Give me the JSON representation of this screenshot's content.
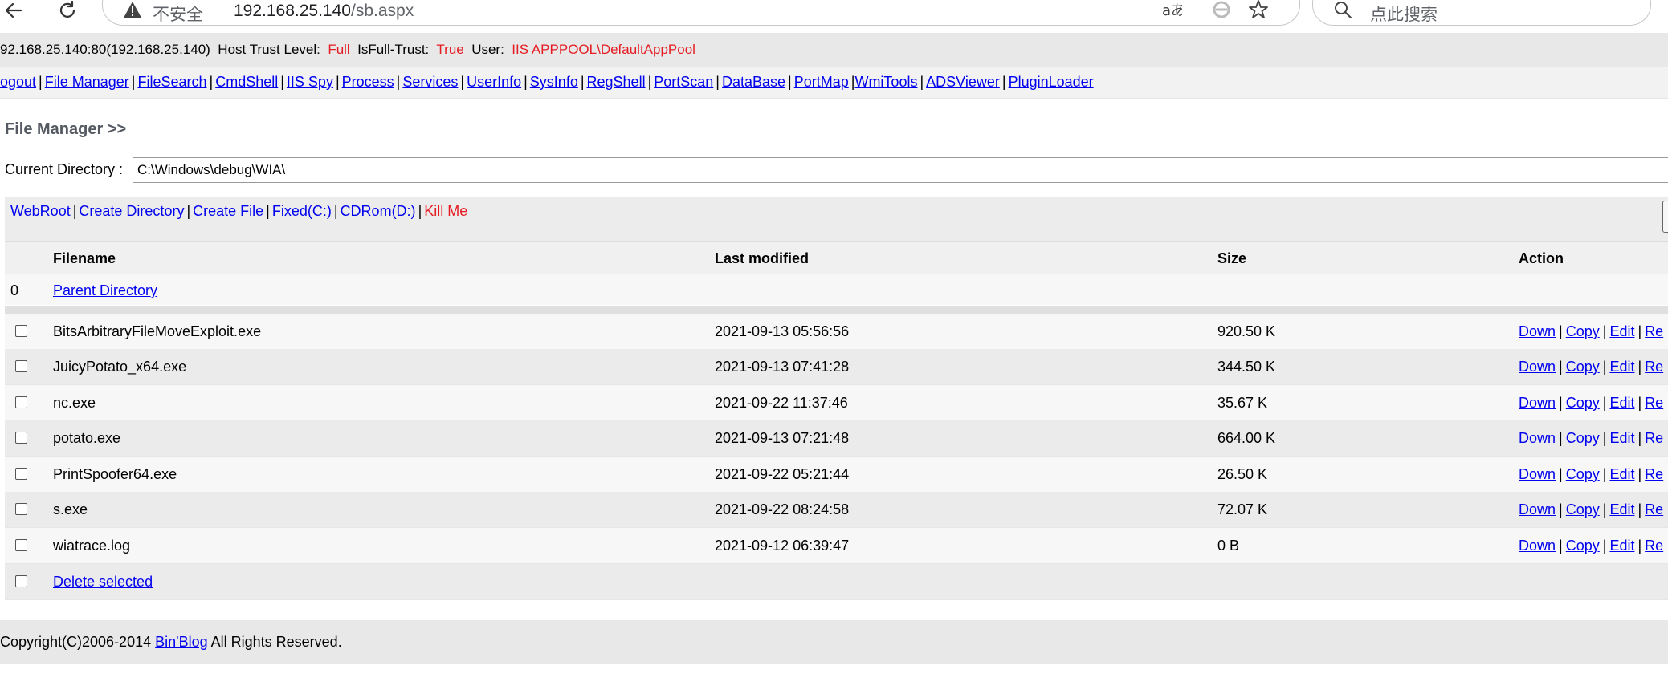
{
  "browser": {
    "insecure_label": "不安全",
    "url_host": "192.168.25.140",
    "url_path": "/sb.aspx",
    "search_placeholder": "点此搜索"
  },
  "info": {
    "host": "92.168.25.140:80(192.168.25.140)",
    "trust_label": "Host Trust Level:",
    "trust_value": "Full",
    "fulltrust_label": "IsFull-Trust:",
    "fulltrust_value": "True",
    "user_label": "User:",
    "user_value": "IIS APPPOOL\\DefaultAppPool"
  },
  "nav": {
    "logout": "ogout",
    "file_manager": "File Manager",
    "file_search": "FileSearch",
    "cmd_shell": "CmdShell",
    "iis_spy": "IIS Spy",
    "process": "Process",
    "services": "Services",
    "userinfo": "UserInfo",
    "sysinfo": "SysInfo",
    "regshell": "RegShell",
    "portscan": "PortScan",
    "database": "DataBase",
    "portmap": "PortMap",
    "wmitools": "WmiTools",
    "adsviewer": "ADSViewer",
    "pluginloader": "PluginLoader"
  },
  "heading": "File Manager >>",
  "current_dir": {
    "label": "Current Directory :",
    "value": "C:\\Windows\\debug\\WIA\\"
  },
  "quick": {
    "webroot": "WebRoot",
    "create_directory": "Create Directory",
    "create_file": "Create File",
    "fixed": "Fixed(C:)",
    "cdrom": "CDRom(D:)",
    "kill_me": "Kill Me"
  },
  "table": {
    "headers": {
      "filename": "Filename",
      "modified": "Last modified",
      "size": "Size",
      "action": "Action"
    },
    "parent": {
      "index": "0",
      "label": "Parent Directory"
    },
    "actions": {
      "down": "Down",
      "copy": "Copy",
      "edit": "Edit",
      "rename": "Re"
    },
    "files": [
      {
        "name": "BitsArbitraryFileMoveExploit.exe",
        "modified": "2021-09-13 05:56:56",
        "size": "920.50 K"
      },
      {
        "name": "JuicyPotato_x64.exe",
        "modified": "2021-09-13 07:41:28",
        "size": "344.50 K"
      },
      {
        "name": "nc.exe",
        "modified": "2021-09-22 11:37:46",
        "size": "35.67 K"
      },
      {
        "name": "potato.exe",
        "modified": "2021-09-13 07:21:48",
        "size": "664.00 K"
      },
      {
        "name": "PrintSpoofer64.exe",
        "modified": "2021-09-22 05:21:44",
        "size": "26.50 K"
      },
      {
        "name": "s.exe",
        "modified": "2021-09-22 08:24:58",
        "size": "72.07 K"
      },
      {
        "name": "wiatrace.log",
        "modified": "2021-09-12 06:39:47",
        "size": "0 B"
      }
    ],
    "delete_selected": "Delete selected"
  },
  "footer": {
    "copyright": "Copyright(C)2006-2014",
    "blog_link": "Bin'Blog",
    "rights": "All Rights Reserved."
  }
}
